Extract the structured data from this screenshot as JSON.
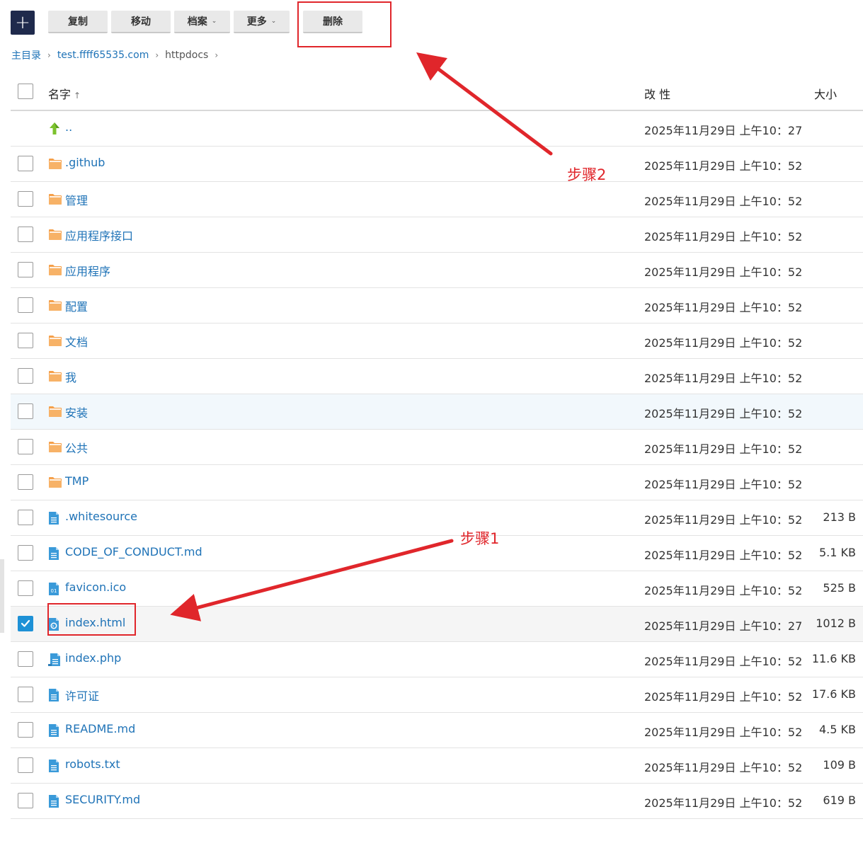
{
  "toolbar": {
    "add_label": "+",
    "buttons": [
      {
        "label": "复制",
        "caret": ""
      },
      {
        "label": "移动",
        "caret": ""
      },
      {
        "label": "档案",
        "caret": "⌄"
      },
      {
        "label": "更多",
        "caret": "⌄"
      },
      {
        "label": "删除",
        "caret": ""
      }
    ]
  },
  "breadcrumb": {
    "items": [
      "主目录",
      "test.ffff65535.com",
      "httpdocs"
    ],
    "separator": "›"
  },
  "table": {
    "columns": {
      "name": "名字",
      "sort_indicator": "↑",
      "modified": "改 性",
      "size": "大小"
    },
    "rows": [
      {
        "type": "up",
        "name": "..",
        "modified": "2025年11月29日 上午10：27",
        "size": "",
        "checkbox": false
      },
      {
        "type": "folder",
        "name": ".github",
        "modified": "2025年11月29日 上午10：52",
        "size": "",
        "checkbox": true
      },
      {
        "type": "folder",
        "name": "管理",
        "modified": "2025年11月29日 上午10：52",
        "size": "",
        "checkbox": true
      },
      {
        "type": "folder",
        "name": "应用程序接口",
        "modified": "2025年11月29日 上午10：52",
        "size": "",
        "checkbox": true
      },
      {
        "type": "folder",
        "name": "应用程序",
        "modified": "2025年11月29日 上午10：52",
        "size": "",
        "checkbox": true
      },
      {
        "type": "folder",
        "name": "配置",
        "modified": "2025年11月29日 上午10：52",
        "size": "",
        "checkbox": true
      },
      {
        "type": "folder",
        "name": "文档",
        "modified": "2025年11月29日 上午10：52",
        "size": "",
        "checkbox": true
      },
      {
        "type": "folder",
        "name": "我",
        "modified": "2025年11月29日 上午10：52",
        "size": "",
        "checkbox": true
      },
      {
        "type": "folder",
        "name": "安装",
        "modified": "2025年11月29日 上午10：52",
        "size": "",
        "checkbox": true,
        "hover": true
      },
      {
        "type": "folder",
        "name": "公共",
        "modified": "2025年11月29日 上午10：52",
        "size": "",
        "checkbox": true
      },
      {
        "type": "folder",
        "name": "TMP",
        "modified": "2025年11月29日 上午10：52",
        "size": "",
        "checkbox": true
      },
      {
        "type": "file",
        "name": ".whitesource",
        "modified": "2025年11月29日 上午10：52",
        "size": "213 B",
        "checkbox": true
      },
      {
        "type": "file",
        "name": "CODE_OF_CONDUCT.md",
        "modified": "2025年11月29日 上午10：52",
        "size": "5.1 KB",
        "checkbox": true
      },
      {
        "type": "ico",
        "name": "favicon.ico",
        "modified": "2025年11月29日 上午10：52",
        "size": "525 B",
        "checkbox": true
      },
      {
        "type": "html",
        "name": "index.html",
        "modified": "2025年11月29日 上午10：27",
        "size": "1012 B",
        "checkbox": true,
        "checked": true
      },
      {
        "type": "php",
        "name": "index.php",
        "modified": "2025年11月29日 上午10：52",
        "size": "11.6 KB",
        "checkbox": true
      },
      {
        "type": "file",
        "name": "许可证",
        "modified": "2025年11月29日 上午10：52",
        "size": "17.6 KB",
        "checkbox": true
      },
      {
        "type": "file",
        "name": "README.md",
        "modified": "2025年11月29日 上午10：52",
        "size": "4.5 KB",
        "checkbox": true
      },
      {
        "type": "file",
        "name": "robots.txt",
        "modified": "2025年11月29日 上午10：52",
        "size": "109 B",
        "checkbox": true
      },
      {
        "type": "file",
        "name": "SECURITY.md",
        "modified": "2025年11月29日 上午10：52",
        "size": "619 B",
        "checkbox": true
      }
    ]
  },
  "annotations": {
    "step1": "步骤1",
    "step2": "步骤2",
    "color": "#e0262b"
  },
  "colors": {
    "link": "#1f73b7",
    "folder": "#f5a04a",
    "file": "#3a9ad9",
    "check": "#1e91d6",
    "add_button": "#1f2a4c"
  }
}
